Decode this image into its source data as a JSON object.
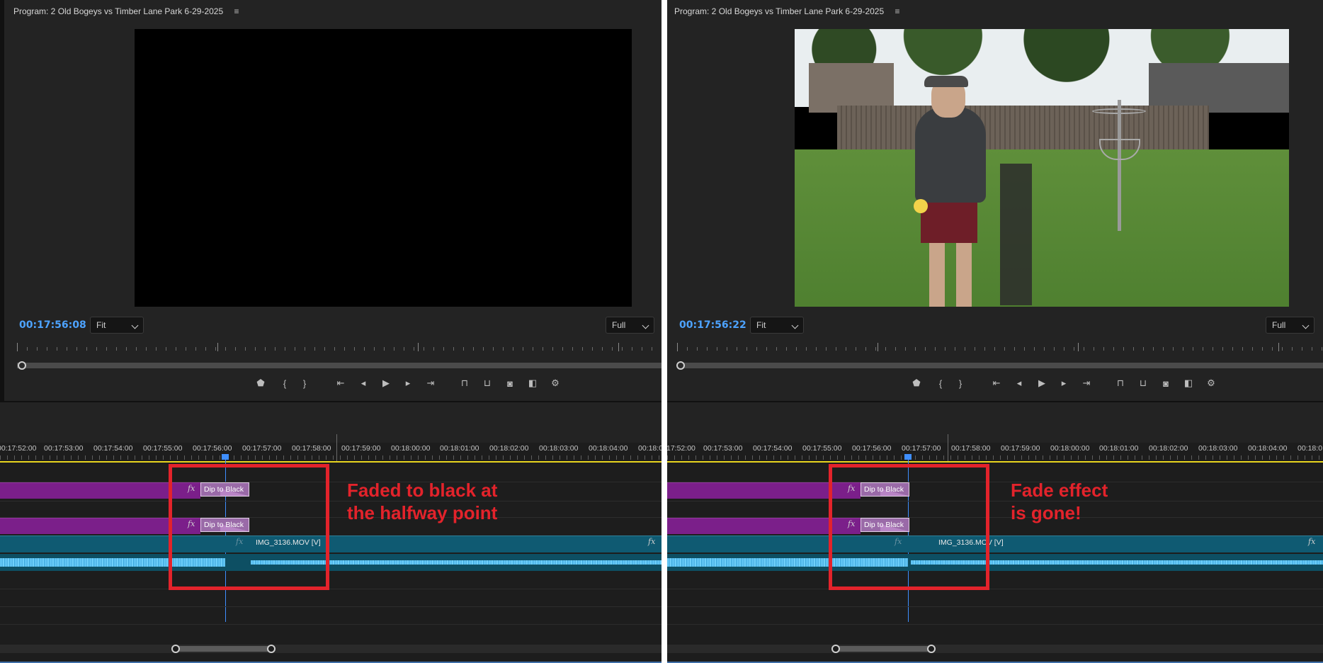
{
  "panes": [
    {
      "id": "left",
      "monitor": {
        "title": "Program: 2 Old Bogeys vs Timber Lane Park 6-29-2025",
        "menu_glyph": "≡",
        "timecode": "00:17:56:08",
        "fit_select": "Fit",
        "quality_select": "Full",
        "frame_content": "black"
      },
      "timeline": {
        "ticks": [
          "00:17:52:00",
          "00:17:53:00",
          "00:17:54:00",
          "00:17:55:00",
          "00:17:56:00",
          "00:17:57:00",
          "00:17:58:00",
          "00:17:59:00",
          "00:18:00:00",
          "00:18:01:00",
          "00:18:02:00",
          "00:18:03:00",
          "00:18:04:00",
          "00:18:0"
        ],
        "clips": {
          "transition_v2": "Dip to Black",
          "transition_v1": "Dip to Black",
          "video_clip": "IMG_3136.MOV [V]",
          "fx_label": "fx"
        }
      },
      "annotation": [
        "Faded to black at",
        "the halfway point"
      ]
    },
    {
      "id": "right",
      "monitor": {
        "title": "Program: 2 Old Bogeys vs Timber Lane Park 6-29-2025",
        "menu_glyph": "≡",
        "timecode": "00:17:56:22",
        "fit_select": "Fit",
        "quality_select": "Full",
        "frame_content": "video"
      },
      "timeline": {
        "ticks": [
          "17:52:00",
          "00:17:53:00",
          "00:17:54:00",
          "00:17:55:00",
          "00:17:56:00",
          "00:17:57:00",
          "00:17:58:00",
          "00:17:59:00",
          "00:18:00:00",
          "00:18:01:00",
          "00:18:02:00",
          "00:18:03:00",
          "00:18:04:00",
          "00:18:0"
        ],
        "clips": {
          "transition_v2": "Dip to Black",
          "transition_v1": "Dip to Black",
          "video_clip": "IMG_3136.MOV [V]",
          "fx_label": "fx"
        }
      },
      "annotation": [
        "Fade effect",
        "is gone!"
      ]
    }
  ],
  "transport_icons": [
    "marker-icon",
    "mark-in-icon",
    "mark-out-icon",
    "go-to-in-icon",
    "step-back-icon",
    "play-icon",
    "step-forward-icon",
    "go-to-out-icon",
    "lift-icon",
    "extract-icon",
    "camera-icon",
    "compare-icon",
    "settings-icon"
  ],
  "colors": {
    "timecode": "#4da3ff",
    "annotation_red": "#e3232b",
    "transition_purple": "#7b1f8a",
    "video_clip_teal": "#0f5a72",
    "audio_wave": "#5fc3f2",
    "playhead": "#3f8fff",
    "work_area": "#e8d51e"
  }
}
